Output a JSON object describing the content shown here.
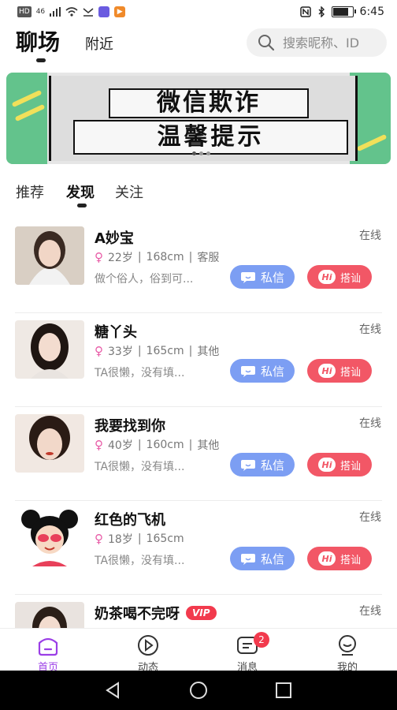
{
  "status_bar": {
    "time": "6:45",
    "left_labels": [
      "HD",
      "46"
    ],
    "icons": [
      "signal-icon",
      "wifi-icon",
      "notification-icon",
      "app-icon",
      "play-icon",
      "nfc-icon",
      "bluetooth-icon",
      "battery-icon"
    ],
    "battery_level": 0.85
  },
  "header": {
    "tab_main": "聊场",
    "tab_nearby": "附近",
    "search_placeholder": "搜索昵称、ID"
  },
  "banner": {
    "line1": "微信欺诈",
    "line2": "温馨提示",
    "colors": {
      "green": "#63c38c",
      "yellow": "#f1e05a"
    }
  },
  "sub_tabs": [
    {
      "label": "推荐"
    },
    {
      "label": "发现"
    },
    {
      "label": "关注"
    }
  ],
  "users": [
    {
      "name": "A妙宝",
      "status": "在线",
      "age": "22岁",
      "height": "168cm",
      "job": "客服",
      "bio": "做个俗人，俗到可...",
      "btn_msg": "私信",
      "btn_hi": "搭讪",
      "vip": ""
    },
    {
      "name": "糖丫头",
      "status": "在线",
      "age": "33岁",
      "height": "165cm",
      "job": "其他",
      "bio": "TA很懒，没有填...",
      "btn_msg": "私信",
      "btn_hi": "搭讪",
      "vip": ""
    },
    {
      "name": "我要找到你",
      "status": "在线",
      "age": "40岁",
      "height": "160cm",
      "job": "其他",
      "bio": "TA很懒，没有填...",
      "btn_msg": "私信",
      "btn_hi": "搭讪",
      "vip": ""
    },
    {
      "name": "红色的飞机",
      "status": "在线",
      "age": "18岁",
      "height": "165cm",
      "job": "",
      "bio": "TA很懒，没有填...",
      "btn_msg": "私信",
      "btn_hi": "搭讪",
      "vip": ""
    },
    {
      "name": "奶茶喝不完呀",
      "status": "在线",
      "age": "",
      "height": "",
      "job": "",
      "bio": "",
      "btn_msg": "",
      "btn_hi": "",
      "vip": "VIP"
    }
  ],
  "bottom_nav": [
    {
      "label": "首页",
      "icon": "home-icon",
      "active": true
    },
    {
      "label": "动态",
      "icon": "play-circle-icon",
      "active": false
    },
    {
      "label": "消息",
      "icon": "message-icon",
      "active": false,
      "badge": "2"
    },
    {
      "label": "我的",
      "icon": "profile-icon",
      "active": false
    }
  ],
  "colors": {
    "accent": "#9b3ee6",
    "message_button": "#7c9ef3",
    "hi_button": "#f25766",
    "vip": "#f23a4d"
  }
}
